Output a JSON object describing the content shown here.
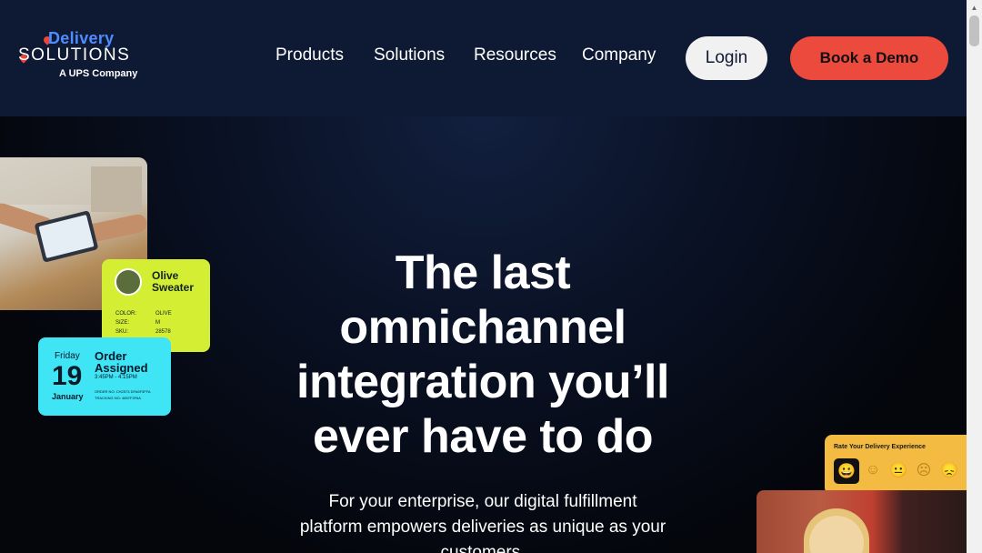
{
  "logo": {
    "top": "Delivery",
    "main": "SOLUTIONS",
    "sub": "A UPS Company"
  },
  "nav": {
    "items": [
      "Products",
      "Solutions",
      "Resources",
      "Company"
    ]
  },
  "buttons": {
    "login": "Login",
    "demo": "Book a Demo"
  },
  "hero": {
    "title_lines": [
      "The last",
      "omnichannel",
      "integration you’ll",
      "ever have to do"
    ],
    "subtitle_lines": [
      "For your enterprise, our digital fulfillment",
      "platform empowers deliveries as unique as your",
      "customers."
    ]
  },
  "product_card": {
    "title_lines": [
      "Olive",
      "Sweater"
    ],
    "rows": [
      {
        "key": "COLOR:",
        "value": "OLIVE"
      },
      {
        "key": "SIZE:",
        "value": "M"
      },
      {
        "key": "SKU:",
        "value": "28578"
      }
    ]
  },
  "order_card": {
    "day": "Friday",
    "date": "19",
    "month": "January",
    "title_lines": [
      "Order",
      "Assigned"
    ],
    "time": "3:45PM - 4:15PM",
    "meta": [
      "ORDER NO:   CH2573 DFA6F3FFA",
      "TRACKING NO:   4857F3F6A"
    ]
  },
  "rating_card": {
    "title": "Rate Your Delivery Experience",
    "faces": [
      "😀",
      "☺",
      "😐",
      "☹",
      "😞"
    ]
  },
  "colors": {
    "header_bg": "#0e1a33",
    "accent": "#ec4a3c",
    "logo_blue": "#4f8cff",
    "lime": "#d4ee34",
    "cyan": "#3fe4f5",
    "amber": "#f3bb42"
  }
}
